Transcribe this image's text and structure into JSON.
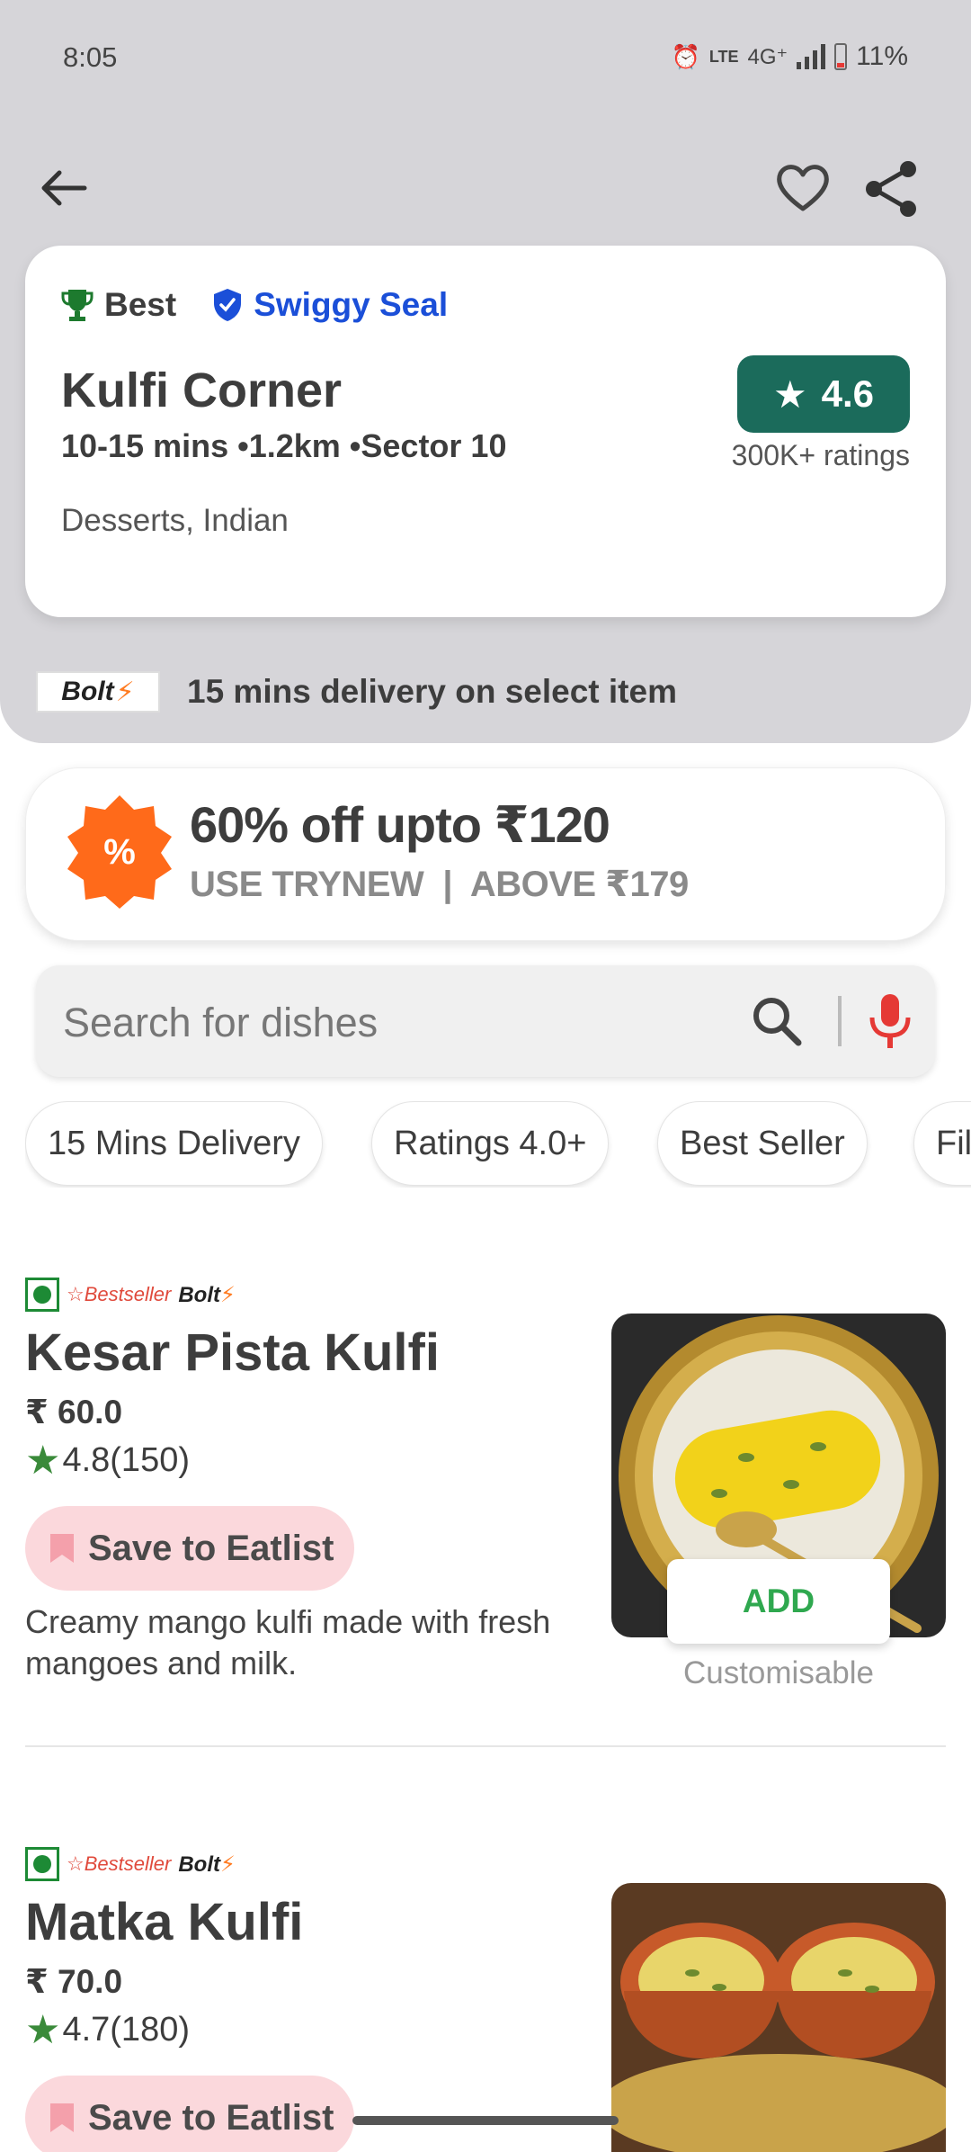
{
  "status_bar": {
    "time": "8:05",
    "network": "4G⁺",
    "battery": "11%"
  },
  "restaurant": {
    "badge_best": "Best",
    "badge_seal": "Swiggy Seal",
    "name": "Kulfi Corner",
    "meta": "10-15 mins •1.2km •Sector 10",
    "cuisine": "Desserts, Indian",
    "rating": "4.6",
    "rating_count": "300K+ ratings",
    "bolt_logo": "Bolt",
    "bolt_text": "15 mins delivery on select item"
  },
  "offer": {
    "title": "60% off upto ₹120",
    "subtitle": "USE TRYNEW  |  ABOVE ₹179",
    "badge_symbol": "%"
  },
  "search": {
    "placeholder": "Search for dishes"
  },
  "filters": [
    "15 Mins Delivery",
    "Ratings 4.0+",
    "Best Seller",
    "Filter"
  ],
  "dishes": [
    {
      "tag_bestseller": "Bestseller",
      "tag_bolt": "Bolt",
      "name": "Kesar Pista Kulfi",
      "price": "₹ 60.0",
      "rating": "4.8(150)",
      "save_label": "Save to Eatlist",
      "description": "Creamy mango kulfi made with fresh mangoes and milk.",
      "add_label": "ADD",
      "customisable": "Customisable"
    },
    {
      "tag_bestseller": "Bestseller",
      "tag_bolt": "Bolt",
      "name": "Matka Kulfi",
      "price": "₹ 70.0",
      "rating": "4.7(180)",
      "save_label": "Save to Eatlist"
    }
  ],
  "colors": {
    "rating_green": "#1b6b5b",
    "seal_blue": "#1b4fd8",
    "add_green": "#2fa84f",
    "offer_orange": "#ff6a1a",
    "save_pink": "#fbd8dc"
  },
  "icons": [
    "back-arrow-icon",
    "heart-icon",
    "share-icon",
    "trophy-icon",
    "shield-icon",
    "star-icon",
    "search-icon",
    "mic-icon",
    "veg-icon",
    "bookmark-icon"
  ]
}
